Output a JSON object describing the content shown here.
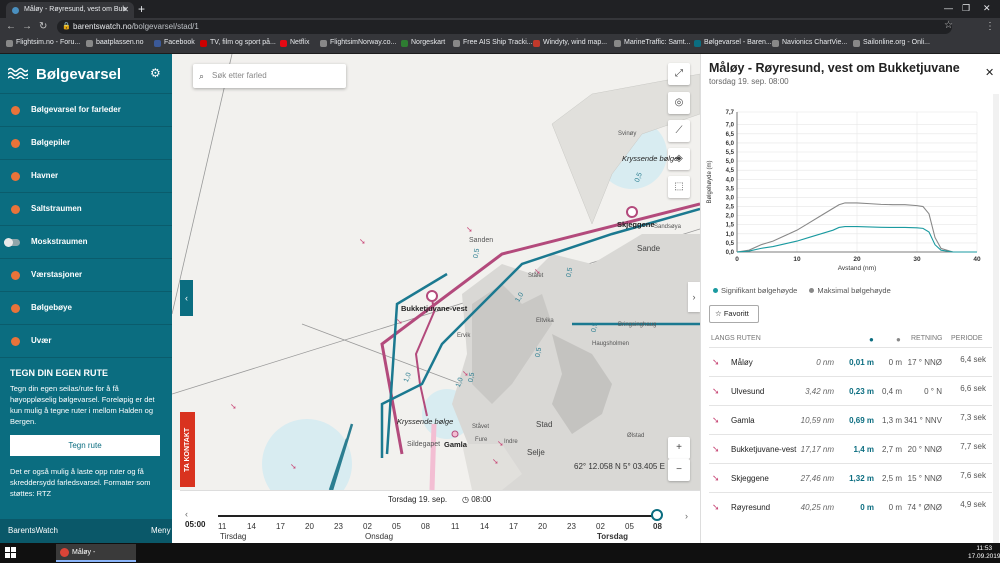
{
  "browser": {
    "tab_title": "Måløy - Røyresund, vest om Buk",
    "url_host": "barentswatch.no",
    "url_path": "/bolgevarsel/stad/1",
    "bookmarks": [
      "Flightsim.no - Foru...",
      "baatplassen.no",
      "Facebook",
      "TV, film og sport på...",
      "Netflix",
      "FlightsimNorway.co...",
      "Norgeskart",
      "Free AIS Ship Tracki...",
      "Windyty, wind map...",
      "MarineTraffic: Samt...",
      "Bølgevarsel - Baren...",
      "Navionics ChartVie...",
      "Sailonline.org - Onli..."
    ]
  },
  "sidebar": {
    "title": "Bølgevarsel",
    "items": [
      {
        "label": "Bølgevarsel for farleder"
      },
      {
        "label": "Bølgepiler"
      },
      {
        "label": "Havner"
      },
      {
        "label": "Saltstraumen"
      },
      {
        "label": "Moskstraumen"
      },
      {
        "label": "Værstasjoner"
      },
      {
        "label": "Bølgebøye"
      },
      {
        "label": "Uvær"
      }
    ],
    "route_title": "TEGN DIN EGEN RUTE",
    "route_text1": "Tegn din egen seilas/rute for å få høyoppløselig bølgevarsel. Foreløpig er det kun mulig å tegne ruter i mellom Halden og Bergen.",
    "route_button": "Tegn rute",
    "route_text2": "Det er også mulig å laste opp ruter og få skreddersydd farledsvarsel. Formater som støttes: RTZ",
    "footer_brand": "BarentsWatch",
    "footer_menu": "Meny"
  },
  "map": {
    "search_placeholder": "Søk etter farled",
    "contact": "TA KONTAKT",
    "coords": "62° 12.058 N 5° 03.405 E",
    "labels": [
      {
        "text": "Bukketjuvane-vest",
        "bold": true
      },
      {
        "text": "Skjeggene",
        "bold": true
      },
      {
        "text": "Gamla",
        "bold": true
      },
      {
        "text": "Kryssende bølge",
        "italic": true
      },
      {
        "text": "Kryssende bølge",
        "italic": true
      },
      {
        "text": "Sanden"
      },
      {
        "text": "Sande"
      },
      {
        "text": "Svinøy"
      },
      {
        "text": "Sandsøya"
      },
      {
        "text": "Stålet"
      },
      {
        "text": "Ervik"
      },
      {
        "text": "Eltvika"
      },
      {
        "text": "Bringsinghaug"
      },
      {
        "text": "Haugsholmen"
      },
      {
        "text": "Ståvet"
      },
      {
        "text": "Sildegapet"
      },
      {
        "text": "Selje"
      },
      {
        "text": "Indre"
      },
      {
        "text": "Stad"
      },
      {
        "text": "Ølstad"
      },
      {
        "text": "Fure"
      },
      {
        "text": "0,5"
      },
      {
        "text": "1,0"
      },
      {
        "text": "1,0"
      },
      {
        "text": "1,0"
      },
      {
        "text": "0,5"
      },
      {
        "text": "0,5"
      },
      {
        "text": "0,5"
      },
      {
        "text": "0,5"
      },
      {
        "text": "0,5"
      }
    ]
  },
  "timeline": {
    "date": "Torsdag 19. sep.",
    "time": "08:00",
    "now": "05:00",
    "ticks": [
      "11",
      "14",
      "17",
      "20",
      "23",
      "02",
      "05",
      "08",
      "11",
      "14",
      "17",
      "20",
      "23",
      "02",
      "05",
      "08"
    ],
    "days": [
      "Tirsdag",
      "Onsdag",
      "Torsdag"
    ]
  },
  "panel": {
    "title": "Måløy - Røyresund, vest om Bukketjuvane",
    "subtitle": "torsdag 19. sep. 08:00",
    "legend_sig": "Signifikant bølgehøyde",
    "legend_max": "Maksimal bølgehøyde",
    "favorite": "Favoritt",
    "headers": {
      "route": "LANGS RUTEN",
      "dir": "RETNING",
      "period": "PERIODE"
    },
    "rows": [
      {
        "name": "Måløy",
        "dist": "0 nm",
        "sig": "0,01 m",
        "max": "0 m",
        "dir": "17 ° NNØ",
        "per": "6,4 sek"
      },
      {
        "name": "Ulvesund",
        "dist": "3,42 nm",
        "sig": "0,23 m",
        "max": "0,4 m",
        "dir": "0 ° N",
        "per": "6,6 sek"
      },
      {
        "name": "Gamla",
        "dist": "10,59 nm",
        "sig": "0,69 m",
        "max": "1,3 m",
        "dir": "341 ° NNV",
        "per": "7,3 sek"
      },
      {
        "name": "Bukketjuvane-vest",
        "dist": "17,17 nm",
        "sig": "1,4 m",
        "max": "2,7 m",
        "dir": "20 ° NNØ",
        "per": "7,7 sek"
      },
      {
        "name": "Skjeggene",
        "dist": "27,46 nm",
        "sig": "1,32 m",
        "max": "2,5 m",
        "dir": "15 ° NNØ",
        "per": "7,6 sek"
      },
      {
        "name": "Røyresund",
        "dist": "40,25 nm",
        "sig": "0 m",
        "max": "0 m",
        "dir": "74 ° ØNØ",
        "per": "4,9 sek"
      }
    ]
  },
  "chart_data": {
    "type": "line",
    "title": "",
    "xlabel": "Avstand (nm)",
    "ylabel": "Bølgehøyde (m)",
    "xlim": [
      0,
      40
    ],
    "ylim": [
      0,
      7.7
    ],
    "xticks": [
      "0",
      "10",
      "20",
      "30",
      "40"
    ],
    "yticks": [
      "0,0",
      "0,5",
      "1,0",
      "1,5",
      "2,0",
      "2,5",
      "3,0",
      "3,5",
      "4,0",
      "4,5",
      "5,0",
      "5,5",
      "6,0",
      "6,5",
      "7,0",
      "7,7"
    ],
    "grid": true,
    "series": [
      {
        "name": "Signifikant bølgehøyde",
        "color": "#1a9aa0",
        "x": [
          0,
          2,
          4,
          6,
          8,
          10,
          12,
          14,
          16,
          17,
          18,
          20,
          22,
          24,
          26,
          28,
          30,
          31,
          32,
          33,
          34,
          36,
          38,
          40
        ],
        "y": [
          0,
          0.05,
          0.2,
          0.3,
          0.45,
          0.6,
          0.8,
          1.0,
          1.2,
          1.35,
          1.4,
          1.4,
          1.38,
          1.36,
          1.35,
          1.35,
          1.33,
          1.3,
          1.1,
          0.4,
          0.1,
          0,
          0,
          0
        ]
      },
      {
        "name": "Maksimal bølgehøyde",
        "color": "#888888",
        "x": [
          0,
          2,
          4,
          6,
          8,
          10,
          12,
          14,
          16,
          17,
          18,
          20,
          22,
          24,
          26,
          28,
          30,
          31,
          32,
          33,
          34,
          36,
          38,
          40
        ],
        "y": [
          0,
          0.1,
          0.4,
          0.6,
          0.9,
          1.2,
          1.6,
          2.0,
          2.4,
          2.6,
          2.7,
          2.7,
          2.66,
          2.62,
          2.6,
          2.6,
          2.55,
          2.5,
          2.1,
          0.8,
          0.2,
          0,
          0,
          0
        ]
      }
    ]
  },
  "taskbar": {
    "app": "Måløy - Røyresund,...",
    "time": "11:53",
    "date": "17.09.2019"
  }
}
